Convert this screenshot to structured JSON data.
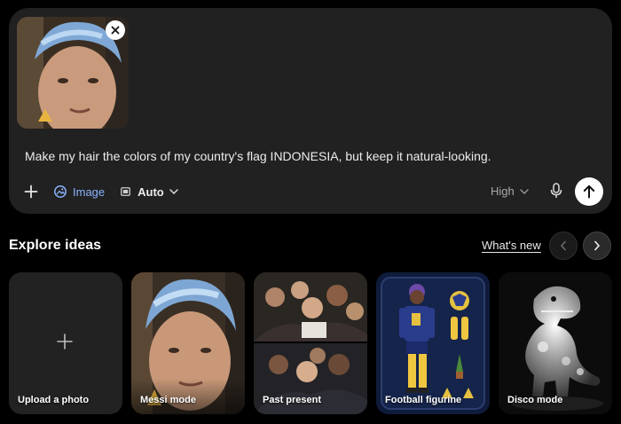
{
  "composer": {
    "prompt": "Make my hair the colors of my country's flag INDONESIA, but keep it natural-looking.",
    "tools": {
      "image_label": "Image",
      "aspect_label": "Auto",
      "quality_label": "High"
    },
    "icons": {
      "close": "close-icon",
      "plus": "plus-icon",
      "image": "image-icon",
      "aspect": "aspect-ratio-icon",
      "chevron": "chevron-down-icon",
      "mic": "microphone-icon",
      "send": "arrow-up-icon"
    },
    "accent_color": "#8ab4ff"
  },
  "explore": {
    "title": "Explore ideas",
    "whats_new": "What's new",
    "cards": [
      {
        "label": "Upload a photo"
      },
      {
        "label": "Messi mode"
      },
      {
        "label": "Past present"
      },
      {
        "label": "Football figurine"
      },
      {
        "label": "Disco mode"
      }
    ]
  }
}
